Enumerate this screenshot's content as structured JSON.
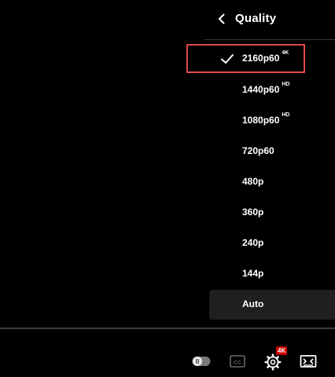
{
  "quality_menu": {
    "title": "Quality",
    "items": [
      {
        "label": "2160p60",
        "badge": "4K",
        "selected": true
      },
      {
        "label": "1440p60",
        "badge": "HD",
        "selected": false
      },
      {
        "label": "1080p60",
        "badge": "HD",
        "selected": false
      },
      {
        "label": "720p60",
        "badge": "",
        "selected": false
      },
      {
        "label": "480p",
        "badge": "",
        "selected": false
      },
      {
        "label": "360p",
        "badge": "",
        "selected": false
      },
      {
        "label": "240p",
        "badge": "",
        "selected": false
      },
      {
        "label": "144p",
        "badge": "",
        "selected": false
      },
      {
        "label": "Auto",
        "badge": "",
        "selected": false
      }
    ]
  },
  "controls": {
    "settings_badge": "4K"
  },
  "icons": {
    "back": "chevron-left-icon",
    "check": "checkmark-icon",
    "autoplay": "autoplay-toggle-icon",
    "cc": "closed-captions-icon",
    "settings": "gear-icon",
    "theater": "theater-mode-icon"
  },
  "colors": {
    "background": "#000000",
    "selected_outline": "#e04b4b",
    "badge_red": "#cc0000",
    "hover_row": "#1f1f1f"
  }
}
